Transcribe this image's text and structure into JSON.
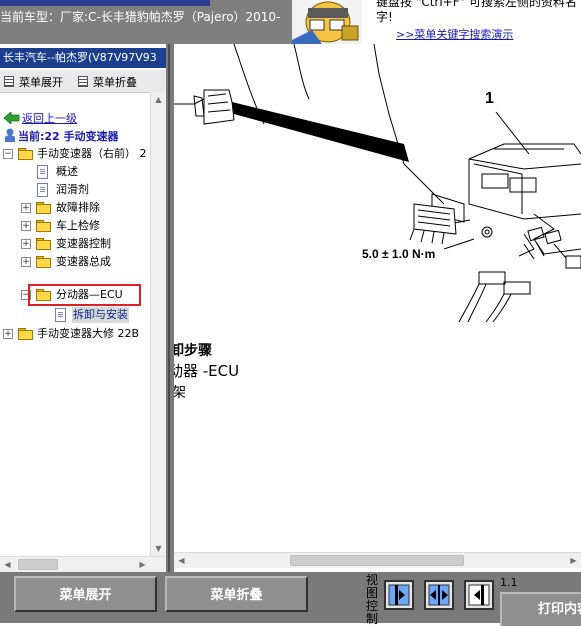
{
  "header": {
    "car_model": "当前车型：厂家:C-长丰猎豹帕杰罗（Pajero）2010-",
    "tip_text": "键盘按 \"Ctrl+F\" 可搜索左侧的资料名字!",
    "tip_link": ">>菜单关键字搜索演示"
  },
  "tree": {
    "title": "长丰汽车--帕杰罗(V87V97V93",
    "expand_label": "菜单展开",
    "collapse_label": "菜单折叠",
    "back_label": "返回上一级",
    "current_label": "当前:22 手动变速器",
    "items": [
      {
        "label": "手动变速器（右前） 2",
        "type": "folder",
        "toggle": "−"
      },
      {
        "label": "概述",
        "type": "doc"
      },
      {
        "label": "润滑剂",
        "type": "doc"
      },
      {
        "label": "故障排除",
        "type": "folder",
        "toggle": "+"
      },
      {
        "label": "车上检修",
        "type": "folder",
        "toggle": "+"
      },
      {
        "label": "变速器控制",
        "type": "folder",
        "toggle": "+"
      },
      {
        "label": "变速器总成",
        "type": "folder",
        "toggle": "+"
      },
      {
        "label": "分动器—ECU",
        "type": "folder",
        "toggle": "−"
      },
      {
        "label": "拆卸与安装",
        "type": "doc"
      },
      {
        "label": "手动变速器大修 22B",
        "type": "folder",
        "toggle": "+"
      }
    ]
  },
  "drawing": {
    "callout_number": "1",
    "torque_spec": "5.0 ± 1.0 N·m",
    "step_title": "卸步骤",
    "step_name": "动器 -ECU",
    "step_more": "架"
  },
  "bottom": {
    "expand_button": "菜单展开",
    "collapse_button": "菜单折叠",
    "view_label": "视图控制",
    "page_number": "1.1",
    "print_button": "打印内容"
  },
  "colors": {
    "header_bg": "#7f7f7f",
    "tree_title_bg": "#1a3f8c",
    "link_blue": "#1a1ab0",
    "highlight_red": "#e02020",
    "bottom_bar": "#7a7a7a"
  },
  "icons": [
    "back-arrow-icon",
    "person-pin-icon",
    "folder-icon",
    "document-icon",
    "expand-box-icon",
    "collapse-box-icon",
    "fit-page-icon",
    "fit-width-icon",
    "actual-size-icon",
    "mascot-icon"
  ]
}
